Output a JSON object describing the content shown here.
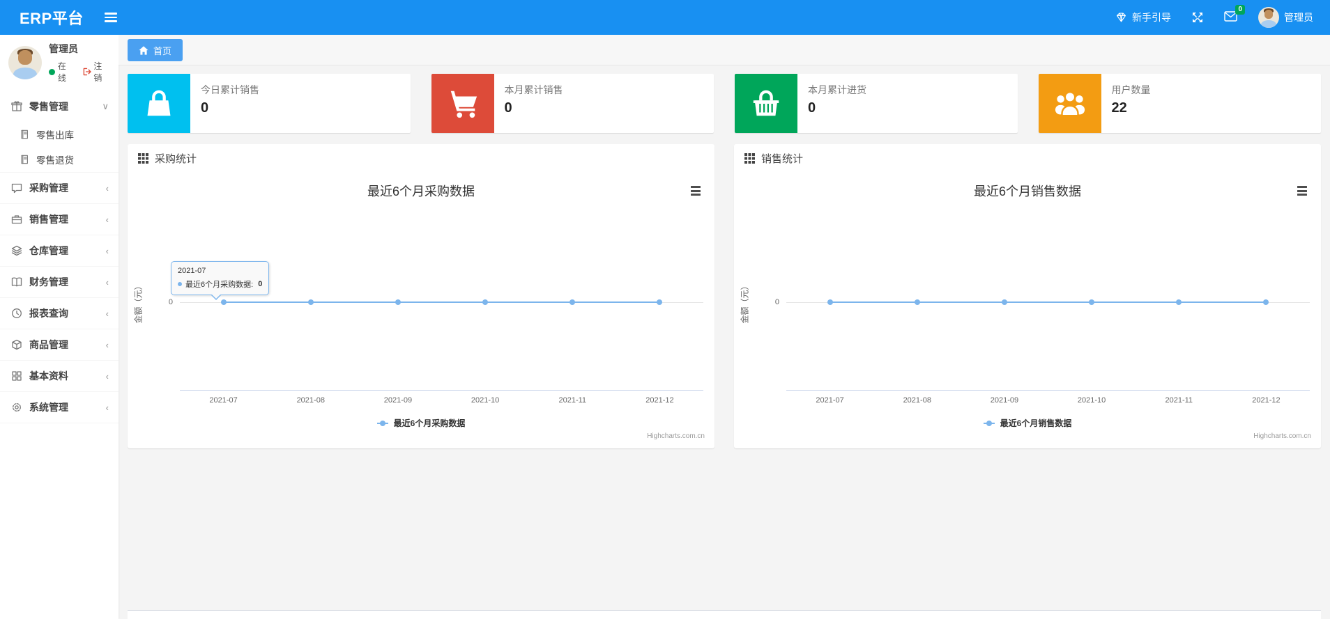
{
  "navbar": {
    "brand": "ERP平台",
    "guide_label": "新手引导",
    "mail_badge_count": "0",
    "user_name": "管理员",
    "bg_color": "#1890f2"
  },
  "sidebar": {
    "user": {
      "name": "管理员",
      "online_status": "在线",
      "logout_label": "注销"
    },
    "menu": [
      {
        "label": "零售管理",
        "icon": "gift-icon",
        "expanded": true,
        "children": [
          {
            "label": "零售出库",
            "icon": "journal-icon"
          },
          {
            "label": "零售退货",
            "icon": "journal-icon"
          }
        ]
      },
      {
        "label": "采购管理",
        "icon": "comment-icon"
      },
      {
        "label": "销售管理",
        "icon": "briefcase-icon"
      },
      {
        "label": "仓库管理",
        "icon": "layers-icon"
      },
      {
        "label": "财务管理",
        "icon": "open-book-icon"
      },
      {
        "label": "报表查询",
        "icon": "clock-icon"
      },
      {
        "label": "商品管理",
        "icon": "cube-icon"
      },
      {
        "label": "基本资料",
        "icon": "grid-icon"
      },
      {
        "label": "系统管理",
        "icon": "gear-icon"
      }
    ]
  },
  "tabbar": {
    "tabs": [
      {
        "label": "首页",
        "active": true
      }
    ]
  },
  "stat_cards": [
    {
      "label": "今日累计销售",
      "value": "0",
      "color": "#00c0ef",
      "icon": "shopping-bag-icon"
    },
    {
      "label": "本月累计销售",
      "value": "0",
      "color": "#dd4b39",
      "icon": "cart-icon"
    },
    {
      "label": "本月累计进货",
      "value": "0",
      "color": "#00a65a",
      "icon": "basket-icon"
    },
    {
      "label": "用户数量",
      "value": "22",
      "color": "#f39c12",
      "icon": "users-icon"
    }
  ],
  "chart_data": [
    {
      "type": "line",
      "panel_title": "采购统计",
      "title": "最近6个月采购数据",
      "categories": [
        "2021-07",
        "2021-08",
        "2021-09",
        "2021-10",
        "2021-11",
        "2021-12"
      ],
      "series": [
        {
          "name": "最近6个月采购数据",
          "values": [
            0,
            0,
            0,
            0,
            0,
            0
          ],
          "color": "#7cb5ec"
        }
      ],
      "ylabel": "金额（元）",
      "ytick": "0",
      "ylim": [
        -1,
        1
      ],
      "grid": "zero gridline only",
      "legend": "最近6个月采购数据",
      "legend_position": "bottom-center",
      "watermark": "Highcharts.com.cn",
      "tooltip": {
        "date": "2021-07",
        "series_label": "最近6个月采购数据:",
        "value": "0"
      }
    },
    {
      "type": "line",
      "panel_title": "销售统计",
      "title": "最近6个月销售数据",
      "categories": [
        "2021-07",
        "2021-08",
        "2021-09",
        "2021-10",
        "2021-11",
        "2021-12"
      ],
      "series": [
        {
          "name": "最近6个月销售数据",
          "values": [
            0,
            0,
            0,
            0,
            0,
            0
          ],
          "color": "#7cb5ec"
        }
      ],
      "ylabel": "金额（元）",
      "ytick": "0",
      "ylim": [
        -1,
        1
      ],
      "grid": "zero gridline only",
      "legend": "最近6个月销售数据",
      "legend_position": "bottom-center",
      "watermark": "Highcharts.com.cn"
    }
  ]
}
